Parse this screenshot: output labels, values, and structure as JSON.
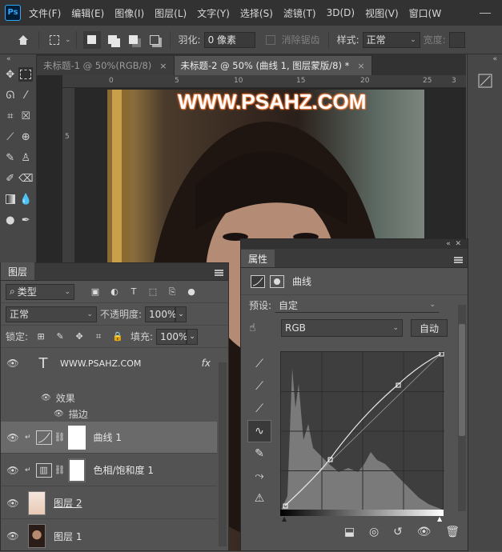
{
  "app": {
    "logo_text": "Ps"
  },
  "menu": [
    "文件(F)",
    "编辑(E)",
    "图像(I)",
    "图层(L)",
    "文字(Y)",
    "选择(S)",
    "滤镜(T)",
    "3D(D)",
    "视图(V)",
    "窗口(W"
  ],
  "options": {
    "feather_label": "羽化:",
    "feather_value": "0 像素",
    "antialias_label": "消除锯齿",
    "style_label": "样式:",
    "style_value": "正常",
    "width_label": "宽度:"
  },
  "tabs": [
    {
      "label": "未标题-1 @ 50%(RGB/8)",
      "close": "×"
    },
    {
      "label": "未标题-2 @ 50% (曲线 1, 图层蒙版/8) *",
      "close": "×"
    }
  ],
  "ruler": {
    "top_ticks": [
      "0",
      "5",
      "10",
      "15",
      "20",
      "25",
      "3"
    ],
    "left_ticks": [
      "5"
    ]
  },
  "canvas": {
    "watermark": "WWW.PSAHZ.COM"
  },
  "layers_panel": {
    "title": "图层",
    "filter_label": "类型",
    "blend_mode": "正常",
    "opacity_label": "不透明度:",
    "opacity_value": "100%",
    "lock_label": "锁定:",
    "fill_label": "填充:",
    "fill_value": "100%",
    "layers": [
      {
        "name": "WWW.PSAHZ.COM",
        "type": "text",
        "fx": "fx",
        "effects_label": "效果",
        "effect_item": "描边"
      },
      {
        "name": "曲线 1",
        "type": "adjustment",
        "active": true
      },
      {
        "name": "色相/饱和度 1",
        "type": "adjustment"
      },
      {
        "name": "图层 2",
        "type": "pixel"
      },
      {
        "name": "图层 1",
        "type": "pixel"
      }
    ]
  },
  "properties_panel": {
    "title": "属性",
    "adjust_title": "曲线",
    "preset_label": "预设:",
    "preset_value": "自定",
    "channel_value": "RGB",
    "auto_button": "自动"
  },
  "colors": {
    "accent": "#31a8ff",
    "panel_bg": "#535353",
    "menubar_bg": "#323232"
  }
}
